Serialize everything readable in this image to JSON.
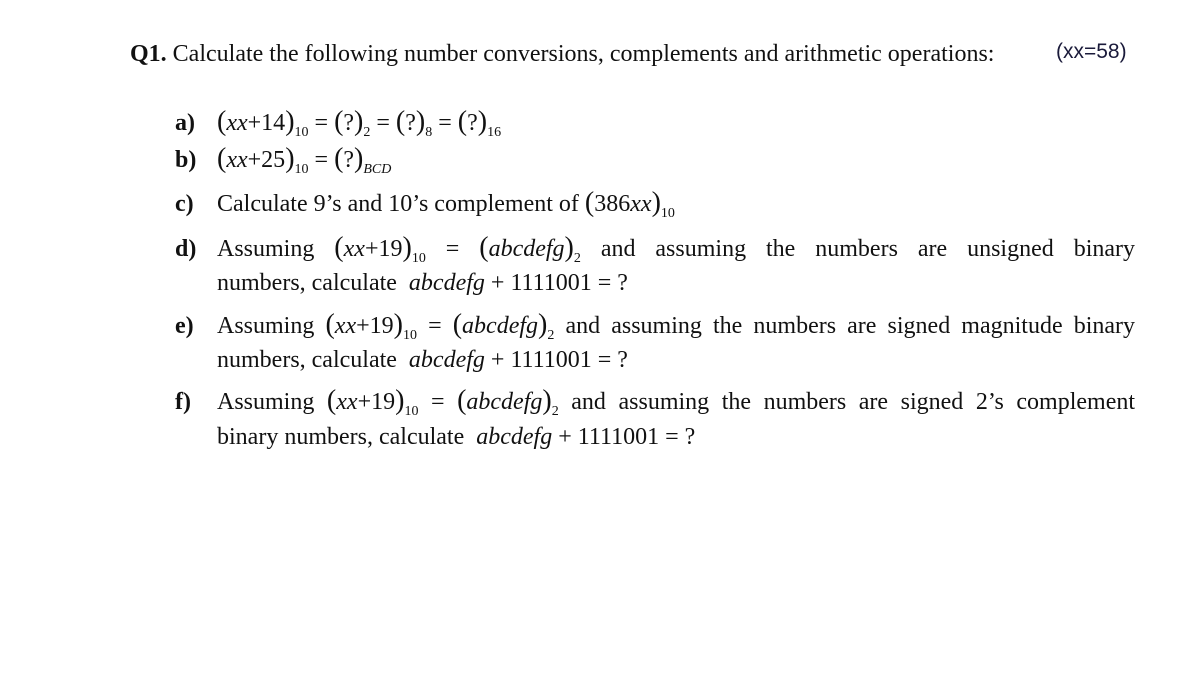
{
  "question": {
    "number": "Q1.",
    "title": "Calculate the following number conversions, complements and arithmetic operations:",
    "note": "(xx=58)"
  },
  "items": [
    {
      "label": "a)",
      "expr": {
        "var": "xx",
        "plus": "+14",
        "base_in": "10",
        "q": "?",
        "bases_out": [
          "2",
          "8",
          "16"
        ]
      }
    },
    {
      "label": "b)",
      "expr": {
        "var": "xx",
        "plus": "+25",
        "base_in": "10",
        "q": "?",
        "base_out": "BCD"
      }
    },
    {
      "label": "c)",
      "text": "Calculate 9’s and 10’s complement of",
      "num": "386",
      "var": "xx",
      "base": "10"
    },
    {
      "label": "d)",
      "lead": "Assuming",
      "var": "xx",
      "plus": "+19",
      "base_in": "10",
      "word": "abcdefg",
      "base_out": "2",
      "tail": "and assuming the numbers are unsigned binary",
      "line2_lead": "numbers, calculate",
      "op": "+ 1111001 = ?"
    },
    {
      "label": "e)",
      "lead": "Assuming",
      "var": "xx",
      "plus": "+19",
      "base_in": "10",
      "word": "abcdefg",
      "base_out": "2",
      "tail": "and assuming the numbers are signed magnitude binary",
      "line2_lead": "numbers, calculate",
      "op": "+ 1111001 = ?"
    },
    {
      "label": "f)",
      "lead": "Assuming",
      "var": "xx",
      "plus": "+19",
      "base_in": "10",
      "word": "abcdefg",
      "base_out": "2",
      "tail": "and assuming the numbers are signed 2’s complement",
      "line2_lead": "binary numbers, calculate",
      "op": "+ 1111001 = ?"
    }
  ]
}
